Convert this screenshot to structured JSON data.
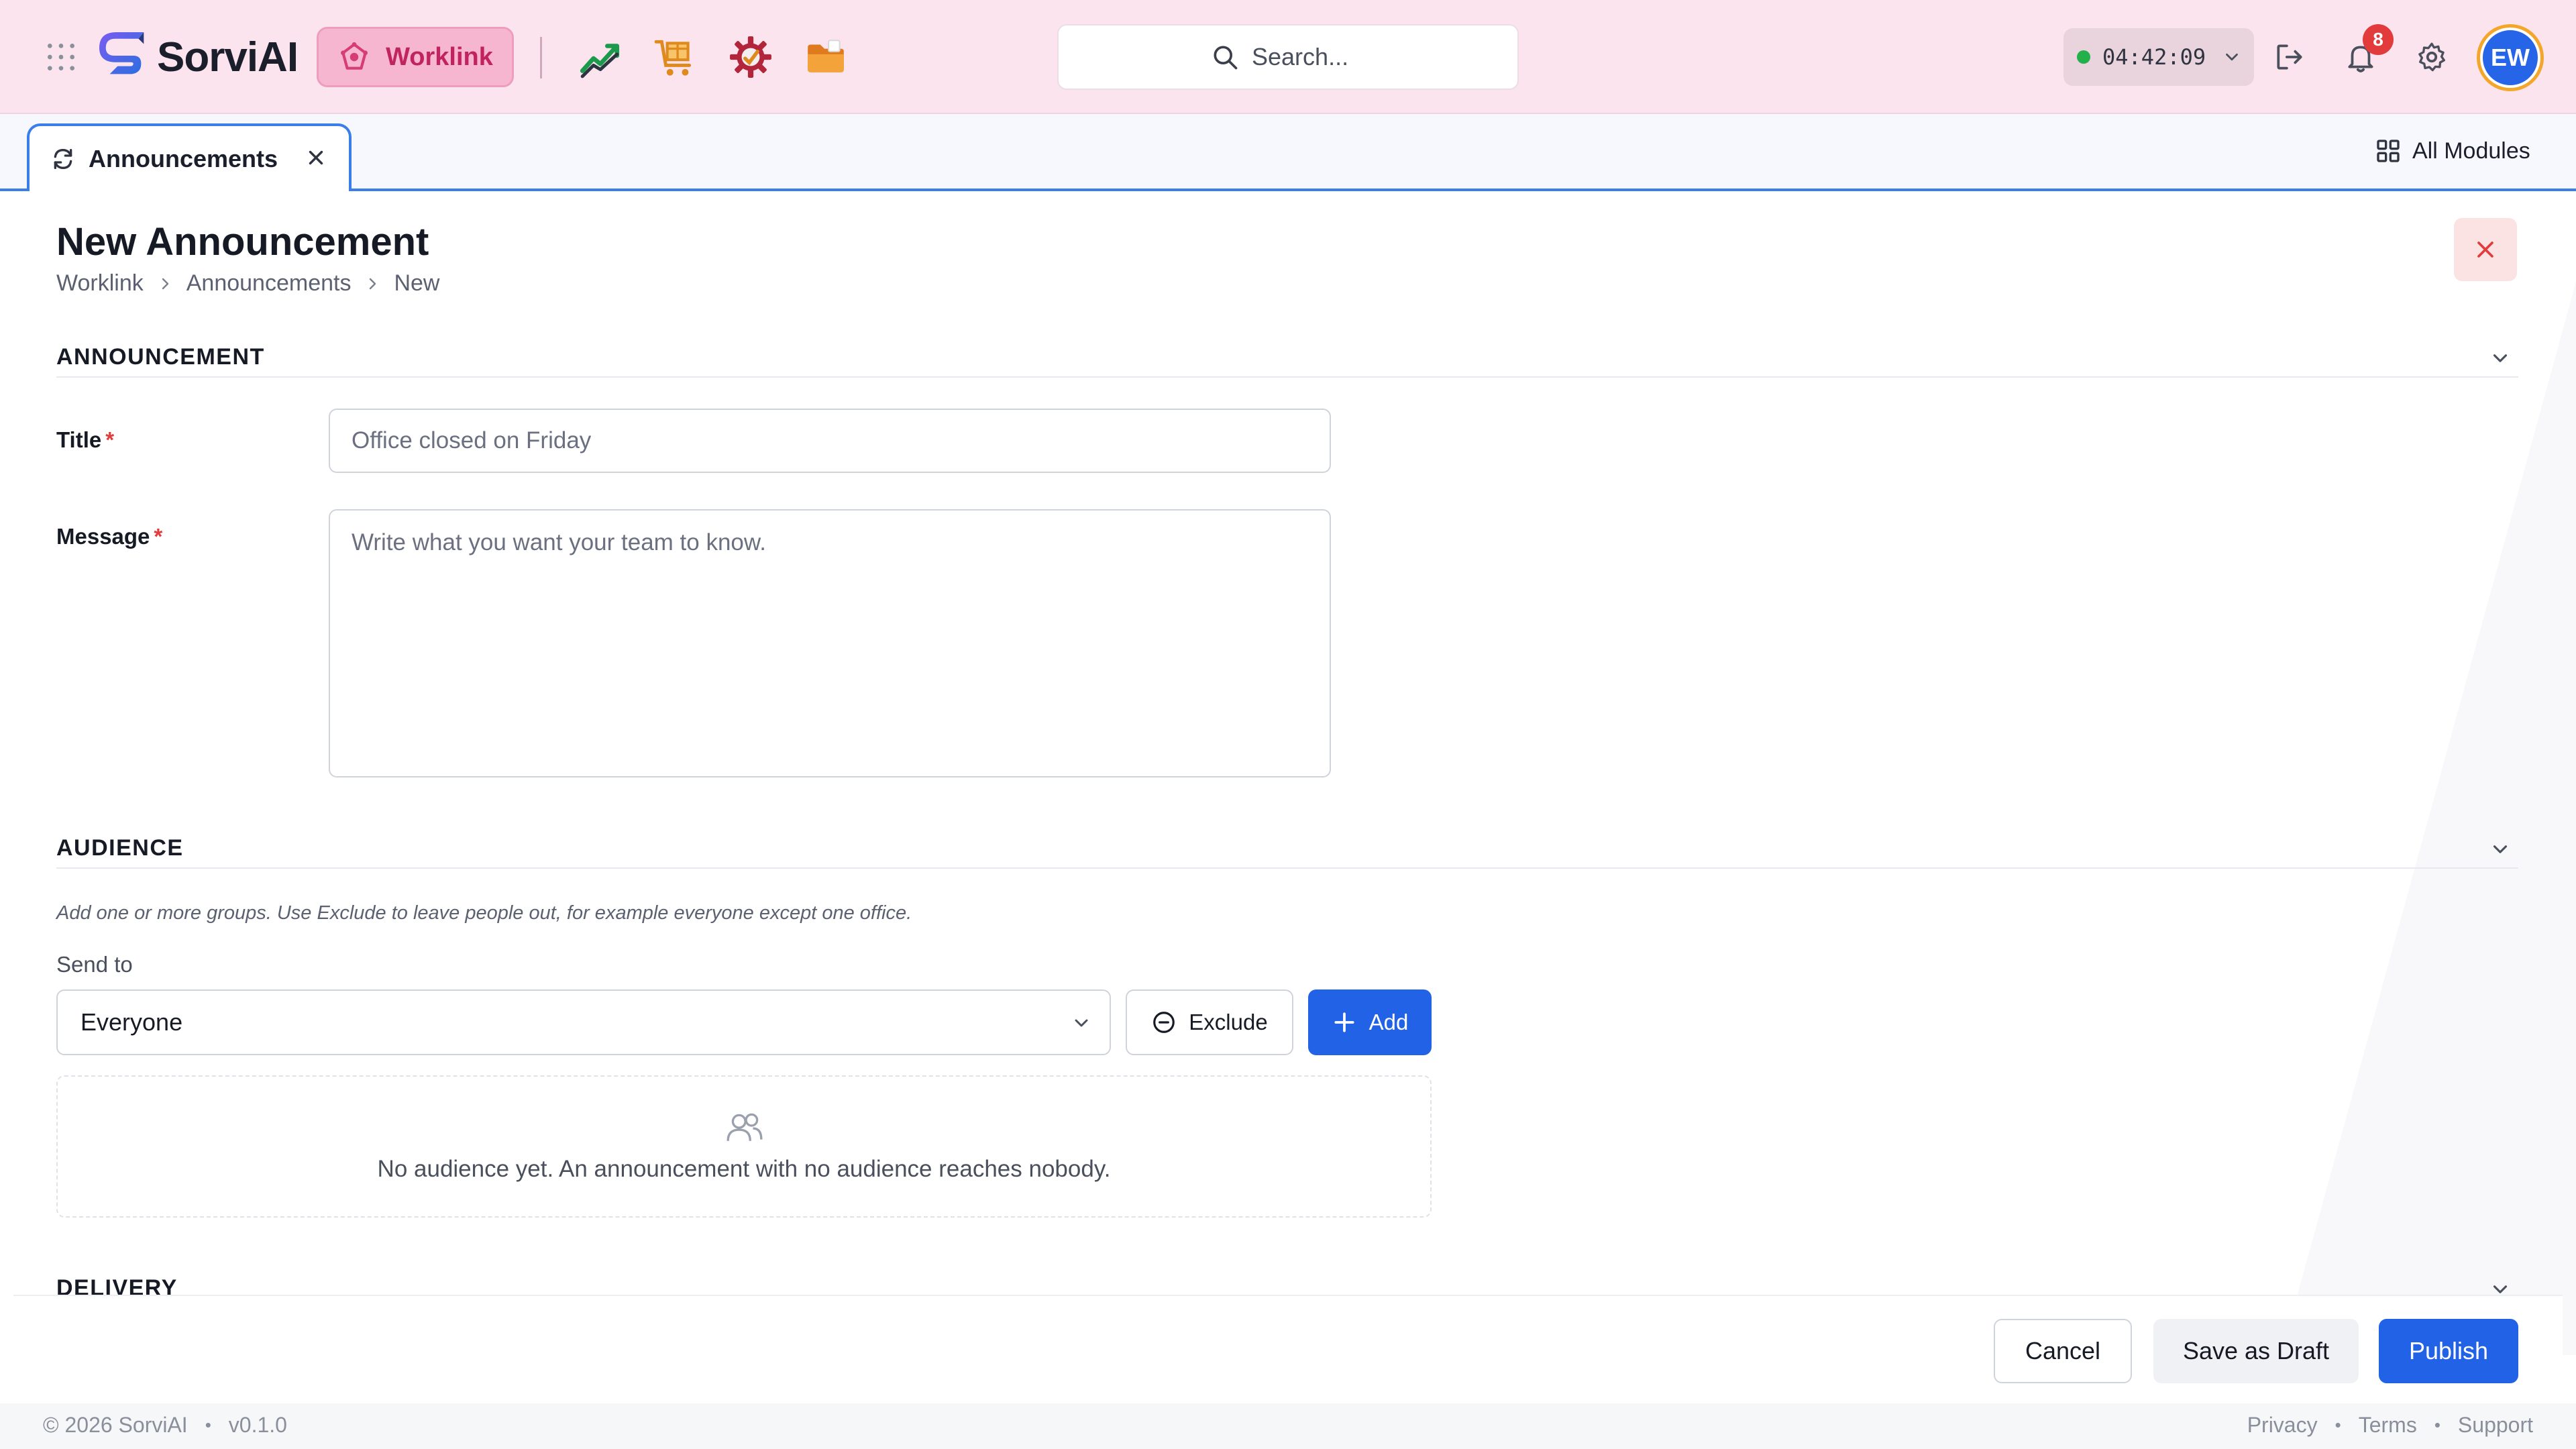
{
  "brand": {
    "name": "SorviAI",
    "active_app": "Worklink"
  },
  "apps": [
    "trend-chart-icon",
    "box-cart-icon",
    "gear-badge-icon",
    "folder-icon"
  ],
  "search": {
    "placeholder": "Search..."
  },
  "timer": {
    "value": "04:42:09",
    "status_color": "#22b04b"
  },
  "notifications": {
    "count": "8"
  },
  "user": {
    "initials": "EW"
  },
  "tabs": [
    {
      "label": "Announcements",
      "active": true
    }
  ],
  "all_modules_label": "All Modules",
  "page": {
    "title": "New Announcement",
    "breadcrumb": [
      "Worklink",
      "Announcements",
      "New"
    ]
  },
  "sections": {
    "announcement": {
      "title": "ANNOUNCEMENT",
      "title_label": "Title",
      "title_placeholder": "Office closed on Friday",
      "title_value": "",
      "message_label": "Message",
      "message_placeholder": "Write what you want your team to know.",
      "message_value": "",
      "required_mark": "*"
    },
    "audience": {
      "title": "AUDIENCE",
      "hint": "Add one or more groups. Use Exclude to leave people out, for example everyone except one office.",
      "send_to_label": "Send to",
      "send_to_value": "Everyone",
      "exclude_label": "Exclude",
      "add_label": "Add",
      "empty_text": "No audience yet. An announcement with no audience reaches nobody."
    },
    "delivery": {
      "title": "DELIVERY"
    }
  },
  "actions": {
    "cancel": "Cancel",
    "save_draft": "Save as Draft",
    "publish": "Publish"
  },
  "footer": {
    "copyright": "© 2026 SorviAI",
    "version": "v0.1.0",
    "links": [
      "Privacy",
      "Terms",
      "Support"
    ]
  },
  "colors": {
    "accent": "#2162e6",
    "brand_pink": "#c0235f",
    "topbar_bg": "#fce4ef",
    "danger": "#e23b3b"
  }
}
